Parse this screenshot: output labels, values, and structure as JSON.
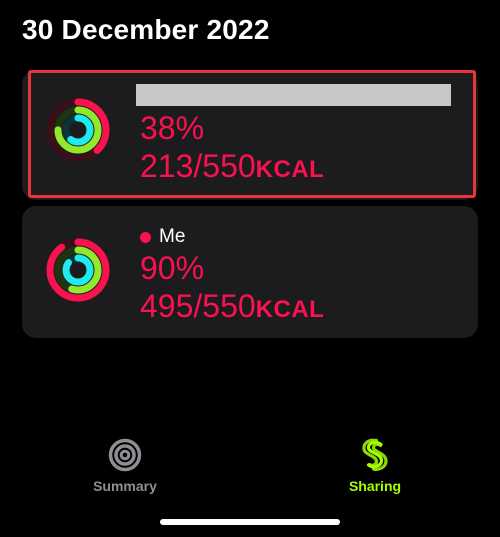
{
  "header": {
    "date": "30 December 2022"
  },
  "friends": [
    {
      "name_redacted": true,
      "name": "",
      "move_percent": "38%",
      "move_value": "213/550",
      "move_unit": "KCAL",
      "rings": {
        "move": 0.38,
        "exercise": 0.75,
        "stand": 0.6
      }
    },
    {
      "name": "Me",
      "move_percent": "90%",
      "move_value": "495/550",
      "move_unit": "KCAL",
      "rings": {
        "move": 0.9,
        "exercise": 0.55,
        "stand": 0.85
      }
    }
  ],
  "tabbar": {
    "summary_label": "Summary",
    "sharing_label": "Sharing",
    "active": "sharing"
  },
  "colors": {
    "move": "#fa114f",
    "exercise": "#92e82a",
    "stand": "#1eeaef",
    "highlight": "#e8343b",
    "card_bg": "#1c1c1e",
    "sharing_accent": "#a6ff00",
    "inactive_tab": "#8e8e93"
  }
}
